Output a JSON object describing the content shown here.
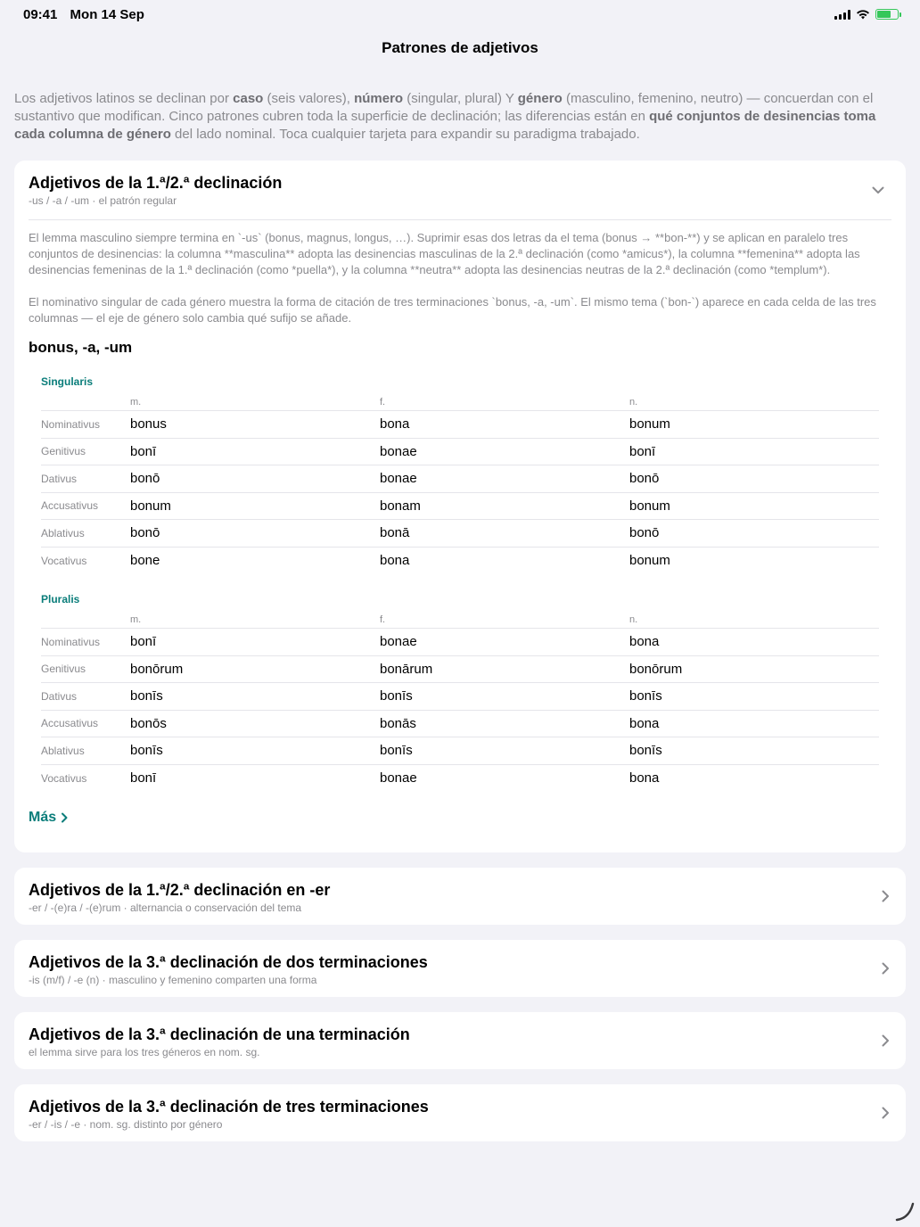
{
  "status": {
    "time": "09:41",
    "date": "Mon 14 Sep"
  },
  "nav": {
    "title": "Patrones de adjetivos"
  },
  "intro": {
    "t1": "Los adjetivos latinos se declinan por ",
    "b1": "caso",
    "t2": " (seis valores), ",
    "b2": "número",
    "t3": " (singular, plural) Y ",
    "b3": "género",
    "t4": " (masculino, femenino, neutro) — concuerdan con el sustantivo que modifican. Cinco patrones cubren toda la superficie de declinación; las diferencias están en ",
    "b4": "qué conjuntos de desinencias toma cada columna de género",
    "t5": " del lado nominal. Toca cualquier tarjeta para expandir su paradigma trabajado."
  },
  "cards": [
    {
      "title": "Adjetivos de la 1.ª/2.ª declinación",
      "subtitle": "-us / -a / -um · el patrón regular",
      "desc1": "El lemma masculino siempre termina en `-us` (bonus, magnus, longus, …). Suprimir esas dos letras da el tema (bonus → **bon-**) y se aplican en paralelo tres conjuntos de desinencias: la columna **masculina** adopta las desinencias masculinas de la 2.ª declinación (como *amicus*), la columna **femenina** adopta las desinencias femeninas de la 1.ª declinación (como *puella*), y la columna **neutra** adopta las desinencias neutras de la 2.ª declinación (como *templum*).",
      "desc2": "El nominativo singular de cada género muestra la forma de citación de tres terminaciones `bonus, -a, -um`. El mismo tema (`bon-`) aparece en cada celda de las tres columnas — el eje de género solo cambia qué sufijo se añade.",
      "lemma": "bonus, -a, -um",
      "genders": [
        "m.",
        "f.",
        "n."
      ],
      "singular": {
        "label": "Singularis",
        "rows": [
          {
            "case": "Nominativus",
            "forms": [
              "bonus",
              "bona",
              "bonum"
            ]
          },
          {
            "case": "Genitivus",
            "forms": [
              "bonī",
              "bonae",
              "bonī"
            ]
          },
          {
            "case": "Dativus",
            "forms": [
              "bonō",
              "bonae",
              "bonō"
            ]
          },
          {
            "case": "Accusativus",
            "forms": [
              "bonum",
              "bonam",
              "bonum"
            ]
          },
          {
            "case": "Ablativus",
            "forms": [
              "bonō",
              "bonā",
              "bonō"
            ]
          },
          {
            "case": "Vocativus",
            "forms": [
              "bone",
              "bona",
              "bonum"
            ]
          }
        ]
      },
      "plural": {
        "label": "Pluralis",
        "rows": [
          {
            "case": "Nominativus",
            "forms": [
              "bonī",
              "bonae",
              "bona"
            ]
          },
          {
            "case": "Genitivus",
            "forms": [
              "bonōrum",
              "bonārum",
              "bonōrum"
            ]
          },
          {
            "case": "Dativus",
            "forms": [
              "bonīs",
              "bonīs",
              "bonīs"
            ]
          },
          {
            "case": "Accusativus",
            "forms": [
              "bonōs",
              "bonās",
              "bona"
            ]
          },
          {
            "case": "Ablativus",
            "forms": [
              "bonīs",
              "bonīs",
              "bonīs"
            ]
          },
          {
            "case": "Vocativus",
            "forms": [
              "bonī",
              "bonae",
              "bona"
            ]
          }
        ]
      },
      "more": "Más"
    },
    {
      "title": "Adjetivos de la 1.ª/2.ª declinación en -er",
      "subtitle": "-er / -(e)ra / -(e)rum · alternancia o conservación del tema"
    },
    {
      "title": "Adjetivos de la 3.ª declinación de dos terminaciones",
      "subtitle": "-is (m/f) / -e (n) · masculino y femenino comparten una forma"
    },
    {
      "title": "Adjetivos de la 3.ª declinación de una terminación",
      "subtitle": "el lemma sirve para los tres géneros en nom. sg."
    },
    {
      "title": "Adjetivos de la 3.ª declinación de tres terminaciones",
      "subtitle": "-er / -is / -e · nom. sg. distinto por género"
    }
  ],
  "colors": {
    "accent": "#0a7d7a",
    "background": "#f2f2f7",
    "secondary_text": "#8a8a8e"
  }
}
